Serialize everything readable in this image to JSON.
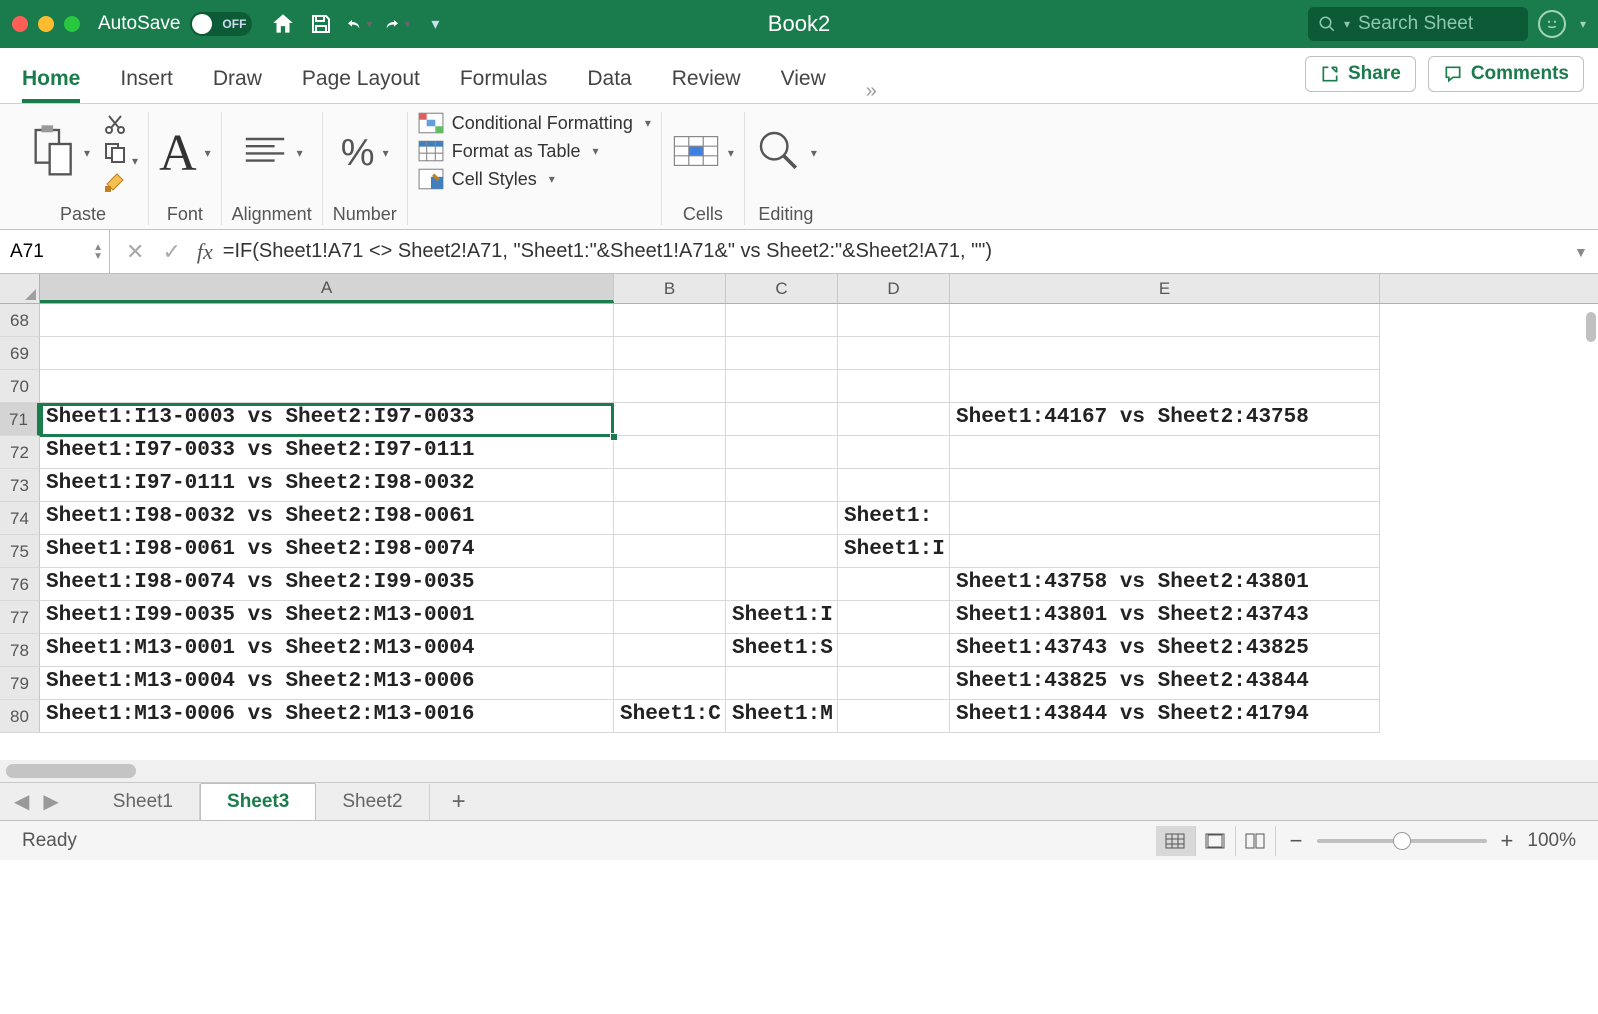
{
  "titlebar": {
    "autosave_label": "AutoSave",
    "autosave_state": "OFF",
    "doc_title": "Book2",
    "search_placeholder": "Search Sheet"
  },
  "ribbon": {
    "tabs": [
      "Home",
      "Insert",
      "Draw",
      "Page Layout",
      "Formulas",
      "Data",
      "Review",
      "View"
    ],
    "active_tab": "Home",
    "share": "Share",
    "comments": "Comments",
    "groups": {
      "paste": "Paste",
      "font": "Font",
      "alignment": "Alignment",
      "number": "Number",
      "cond_fmt": "Conditional Formatting",
      "fmt_table": "Format as Table",
      "cell_styles": "Cell Styles",
      "cells": "Cells",
      "editing": "Editing"
    }
  },
  "formula_bar": {
    "name_box": "A71",
    "formula": "=IF(Sheet1!A71 <> Sheet2!A71, \"Sheet1:\"&Sheet1!A71&\" vs Sheet2:\"&Sheet2!A71, \"\")"
  },
  "columns": [
    "A",
    "B",
    "C",
    "D",
    "E"
  ],
  "selected_col": "A",
  "selected_row": 71,
  "rows": [
    {
      "n": 68,
      "A": "",
      "B": "",
      "C": "",
      "D": "",
      "E": ""
    },
    {
      "n": 69,
      "A": "",
      "B": "",
      "C": "",
      "D": "",
      "E": ""
    },
    {
      "n": 70,
      "A": "",
      "B": "",
      "C": "",
      "D": "",
      "E": ""
    },
    {
      "n": 71,
      "A": "Sheet1:I13-0003 vs Sheet2:I97-0033",
      "B": "",
      "C": "",
      "D": "",
      "E": "Sheet1:44167 vs Sheet2:43758"
    },
    {
      "n": 72,
      "A": "Sheet1:I97-0033 vs Sheet2:I97-0111",
      "B": "",
      "C": "",
      "D": "",
      "E": ""
    },
    {
      "n": 73,
      "A": "Sheet1:I97-0111 vs Sheet2:I98-0032",
      "B": "",
      "C": "",
      "D": "",
      "E": ""
    },
    {
      "n": 74,
      "A": "Sheet1:I98-0032 vs Sheet2:I98-0061",
      "B": "",
      "C": "",
      "D": "Sheet1:",
      "E": ""
    },
    {
      "n": 75,
      "A": "Sheet1:I98-0061 vs Sheet2:I98-0074",
      "B": "",
      "C": "",
      "D": "Sheet1:I",
      "E": ""
    },
    {
      "n": 76,
      "A": "Sheet1:I98-0074 vs Sheet2:I99-0035",
      "B": "",
      "C": "",
      "D": "",
      "E": "Sheet1:43758 vs Sheet2:43801"
    },
    {
      "n": 77,
      "A": "Sheet1:I99-0035 vs Sheet2:M13-0001",
      "B": "",
      "C": "Sheet1:I",
      "D": "",
      "E": "Sheet1:43801 vs Sheet2:43743"
    },
    {
      "n": 78,
      "A": "Sheet1:M13-0001 vs Sheet2:M13-0004",
      "B": "",
      "C": "Sheet1:S",
      "D": "",
      "E": "Sheet1:43743 vs Sheet2:43825"
    },
    {
      "n": 79,
      "A": "Sheet1:M13-0004 vs Sheet2:M13-0006",
      "B": "",
      "C": "",
      "D": "",
      "E": "Sheet1:43825 vs Sheet2:43844"
    },
    {
      "n": 80,
      "A": "Sheet1:M13-0006 vs Sheet2:M13-0016",
      "B": "Sheet1:C",
      "C": "Sheet1:M",
      "D": "",
      "E": "Sheet1:43844 vs Sheet2:41794"
    }
  ],
  "sheet_tabs": [
    "Sheet1",
    "Sheet3",
    "Sheet2"
  ],
  "active_sheet": "Sheet3",
  "statusbar": {
    "status": "Ready",
    "zoom": "100%"
  }
}
